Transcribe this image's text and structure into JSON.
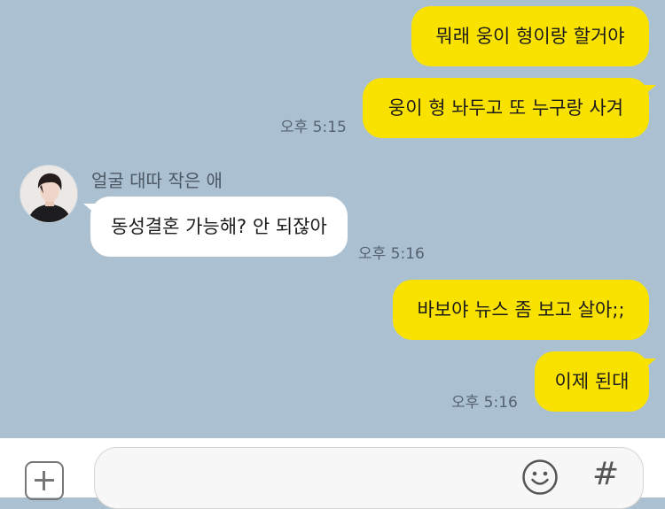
{
  "messages": [
    {
      "text": "뭐래 웅이 형이랑 할거야"
    },
    {
      "text": "웅이 형 놔두고 또 누구랑 사겨",
      "time": "오후 5:15"
    },
    {
      "sender": "얼굴 대따 작은 애",
      "text": "동성결혼 가능해? 안 되잖아",
      "time": "오후 5:16"
    },
    {
      "text": "바보야 뉴스 좀 보고 살아;;"
    },
    {
      "text": "이제 된대",
      "time": "오후 5:16"
    }
  ],
  "input": {
    "placeholder": ""
  },
  "icons": {
    "add": "plus-square-icon",
    "emoji": "smiley-icon",
    "hashtag": "hash-icon"
  },
  "colors": {
    "background": "#abc1d1",
    "my_bubble": "#fae200",
    "other_bubble": "#ffffff"
  }
}
